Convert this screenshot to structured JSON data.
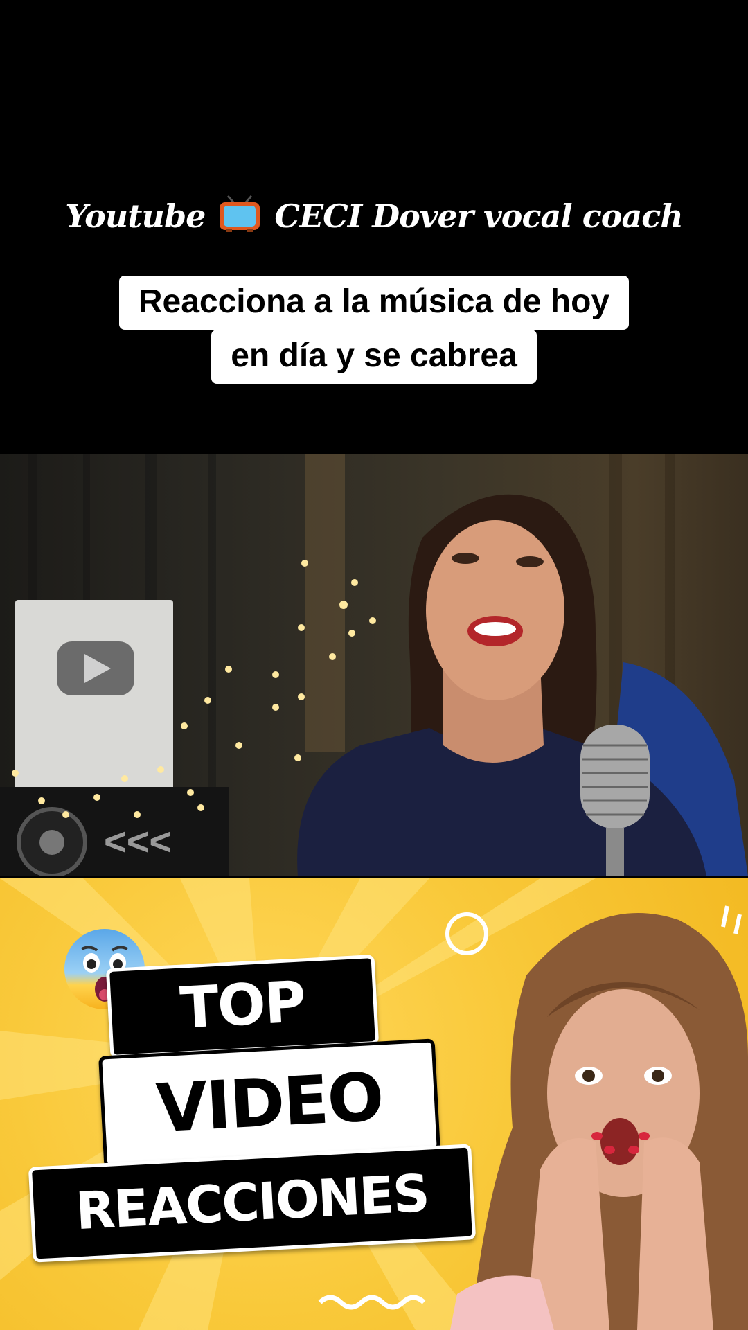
{
  "header": {
    "channel_prefix": "Youtube",
    "channel_name": "CECI Dover vocal coach",
    "caption_line1": "Reacciona a la música de hoy",
    "caption_line2": "en día y se cabrea"
  },
  "thumbnail": {
    "tag_top": "TOP",
    "tag_video": "VIDEO",
    "tag_reactions": "REACCIONES"
  },
  "colors": {
    "background": "#000000",
    "thumbnail_yellow": "#f9c93a",
    "caption_box": "#ffffff"
  },
  "icons": [
    "tv-icon",
    "fearful-face-emoji"
  ]
}
